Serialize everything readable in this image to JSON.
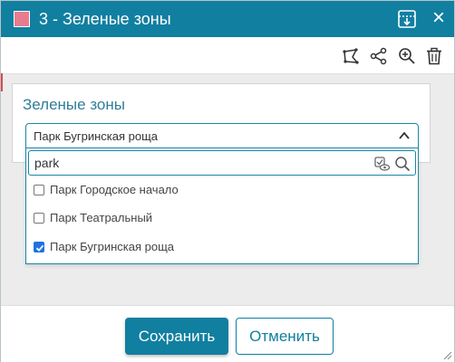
{
  "dialog": {
    "title": "3 - Зеленые зоны",
    "swatch_color": "#e77c8f",
    "title_icons": [
      "export-icon",
      "close-icon"
    ],
    "close_glyph": "×"
  },
  "toolbar": {
    "icons": [
      "polygon-draw-icon",
      "share-icon",
      "zoom-in-icon",
      "trash-icon"
    ]
  },
  "card": {
    "title": "Зеленые зоны"
  },
  "select": {
    "value": "Парк Бугринская роща"
  },
  "dropdown": {
    "search_value": "park",
    "items": [
      {
        "label": "Парк Городское начало",
        "checked": false
      },
      {
        "label": "Парк Театральный",
        "checked": false
      },
      {
        "label": "Парк Бугринская роща",
        "checked": true
      }
    ]
  },
  "footer": {
    "save_label": "Сохранить",
    "cancel_label": "Отменить"
  },
  "colors": {
    "accent": "#117fa0",
    "checkbox_checked": "#1e74e0"
  }
}
